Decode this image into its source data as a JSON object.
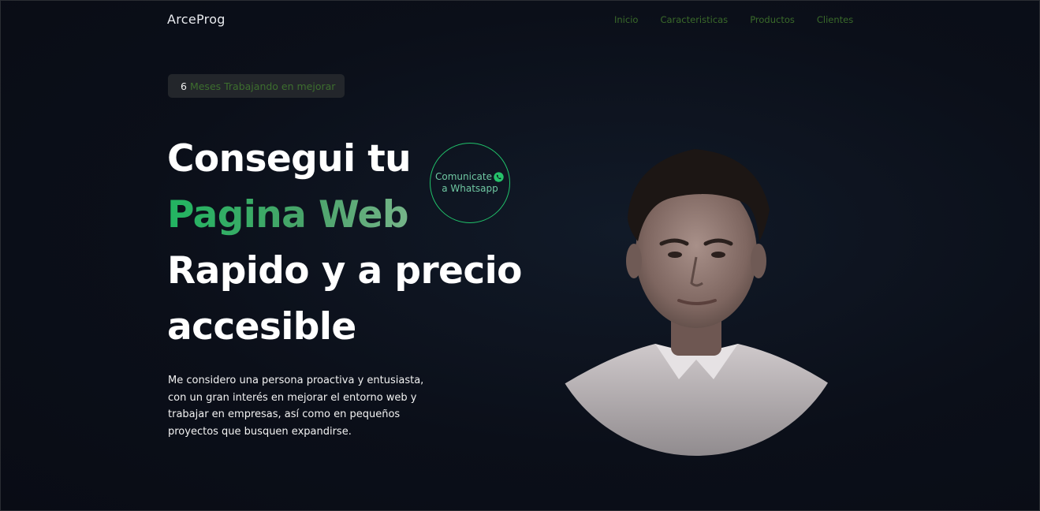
{
  "brand": "ArceProg",
  "nav": {
    "items": [
      "Inicio",
      "Caracteristicas",
      "Productos",
      "Clientes"
    ]
  },
  "badge": {
    "number": "6",
    "text": "Meses Trabajando en mejorar"
  },
  "headline": {
    "line1": "Consegui tu",
    "line2": "Pagina Web",
    "line3": "Rapido y a precio",
    "line4": "accesible"
  },
  "description": "Me considero una persona proactiva y entusiasta, con un gran interés en mejorar el entorno web y trabajar en empresas, así como en pequeños proyectos que busquen expandirse.",
  "whatsapp_button": {
    "line1": "Comunicate",
    "line2": "a Whatsapp",
    "icon": "whatsapp-icon"
  },
  "colors": {
    "background": "#0b0f19",
    "accent_green": "#22b561",
    "nav_link": "#3a6a2a",
    "badge_bg": "#23262b"
  }
}
